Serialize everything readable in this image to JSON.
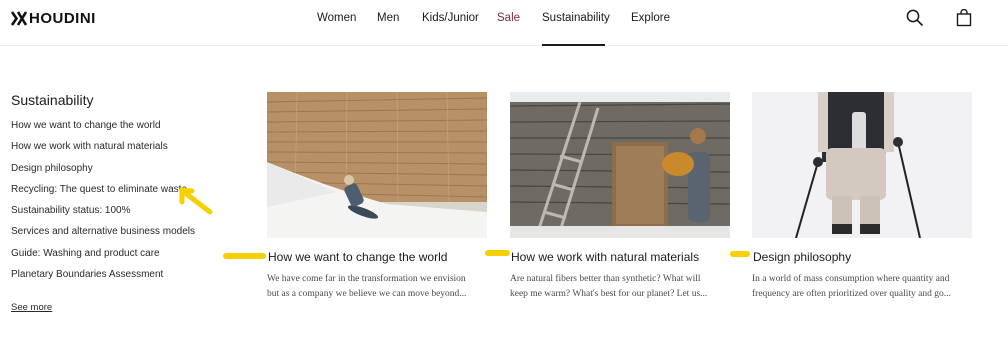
{
  "header": {
    "brand": "HOUDINI",
    "nav": [
      "Women",
      "Men",
      "Kids/Junior",
      "Sale",
      "Sustainability",
      "Explore"
    ],
    "active_nav": "Sustainability",
    "icons": [
      "search-icon",
      "shopping-bag-icon"
    ]
  },
  "sidebar": {
    "title": "Sustainability",
    "items": [
      "How we want to change the world",
      "How we work with natural materials",
      "Design philosophy",
      "Recycling: The quest to eliminate waste",
      "Sustainability status: 100%",
      "Services and alternative business models",
      "Guide: Washing and product care",
      "Planetary Boundaries Assessment"
    ],
    "see_more": "See more"
  },
  "cards": [
    {
      "title": "How we want to change the world",
      "desc_line1": "We have come far in the transformation we envision",
      "desc_line2": "but as a company we believe we can move beyond..."
    },
    {
      "title": "How we work with natural materials",
      "desc_line1": "Are natural fibers better than synthetic? What will",
      "desc_line2": "keep me warm? What's best for our planet? Let us..."
    },
    {
      "title": "Design philosophy",
      "desc_line1": "In a world of mass consumption where quantity and",
      "desc_line2": "frequency are often prioritized over quality and go..."
    }
  ],
  "colors": {
    "sale": "#7a2b45",
    "highlight": "#f6d000"
  }
}
